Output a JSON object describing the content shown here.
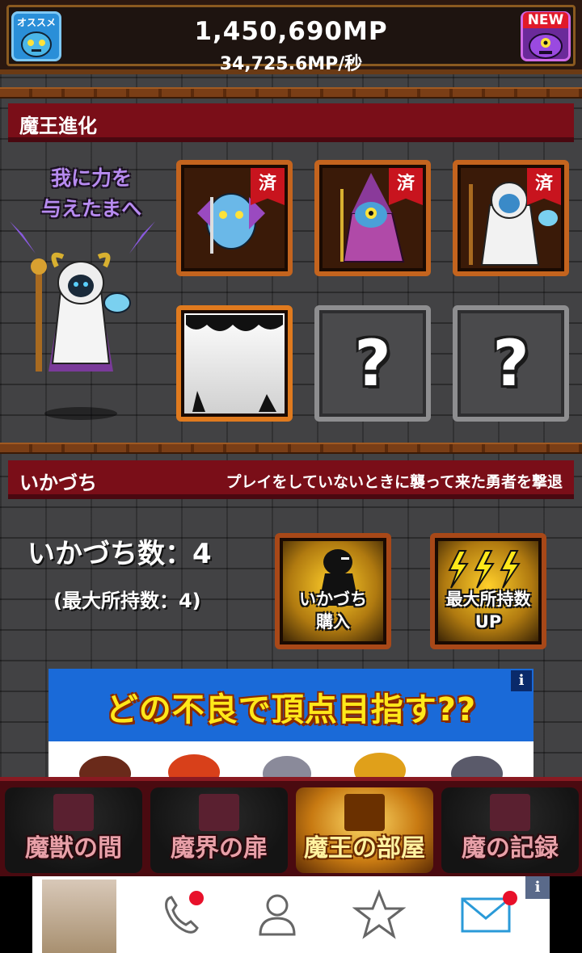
{
  "header": {
    "mp_total": "1,450,690MP",
    "mp_rate": "34,725.6MP/秒",
    "osusume_label": "オススメ",
    "new_label": "NEW"
  },
  "evolution": {
    "title": "魔王進化",
    "speech": "我に力を与えたまへ",
    "done_badge": "済",
    "locked_symbol": "?",
    "slots": [
      {
        "state": "done",
        "creature": "blue-demon-with-fork"
      },
      {
        "state": "done",
        "creature": "purple-robed-cyclops-wizard"
      },
      {
        "state": "done",
        "creature": "hooded-horned-reaper"
      },
      {
        "state": "current",
        "creature": "white-silhouette"
      },
      {
        "state": "locked"
      },
      {
        "state": "locked"
      }
    ]
  },
  "ikazuchi": {
    "title": "いかづち",
    "description": "プレイをしていないときに襲って来た勇者を撃退",
    "count_label": "いかづち数：4",
    "max_label": "(最大所持数：4)",
    "buy_label": "いかづち購入",
    "max_up_label": "最大所持数UP"
  },
  "ad": {
    "headline": "どの不良で頂点目指す??",
    "info": "i"
  },
  "nav": {
    "items": [
      {
        "label": "魔獣の間",
        "active": false
      },
      {
        "label": "魔界の扉",
        "active": false
      },
      {
        "label": "魔王の部屋",
        "active": true
      },
      {
        "label": "魔の記録",
        "active": false
      }
    ]
  },
  "bottom_ad": {
    "info": "i",
    "icons": [
      "phone-icon",
      "person-icon",
      "star-icon",
      "mail-icon"
    ]
  },
  "colors": {
    "banner_red": "#7a0e18",
    "frame_orange": "#c4641e",
    "gold": "#ffcf2a",
    "badge_red": "#c8141e"
  }
}
